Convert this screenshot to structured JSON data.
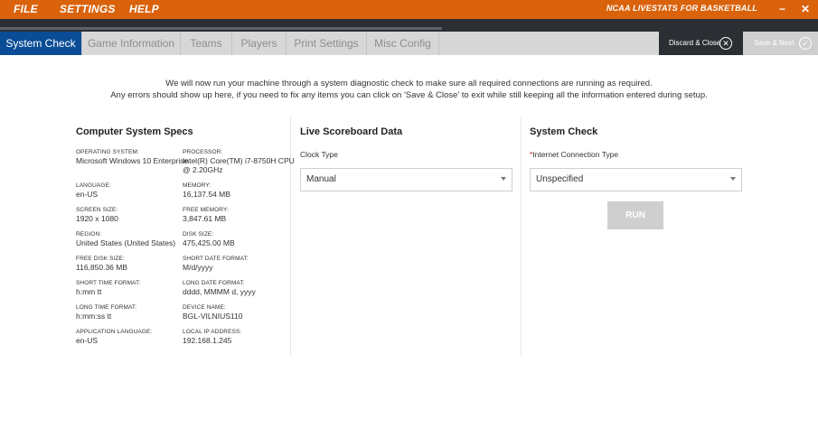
{
  "menu": {
    "file": "FILE",
    "settings": "SETTINGS",
    "help": "HELP"
  },
  "app_title": "NCAA LIVESTATS FOR BASKETBALL",
  "window": {
    "minimize": "−",
    "close": "✕"
  },
  "colors": {
    "brand_orange": "#d9620b",
    "active_tab": "#0a4c96",
    "dark_bar": "#2b2e33"
  },
  "progress_fraction": 0.54,
  "tabs": [
    {
      "label": "System Check"
    },
    {
      "label": "Game Information"
    },
    {
      "label": "Teams"
    },
    {
      "label": "Players"
    },
    {
      "label": "Print Settings"
    },
    {
      "label": "Misc Config"
    }
  ],
  "actions": {
    "discard_label": "Discard & Close",
    "discard_icon": "✕",
    "save_label": "Save & Next",
    "save_icon": "✓"
  },
  "intro": {
    "line1": "We will now run your machine through a system diagnostic check to make sure all required connections are running as required.",
    "line2": "Any errors should show up here, if you need to fix any items you can click on 'Save & Close' to exit while still keeping all the information entered during setup."
  },
  "specs": {
    "title": "Computer System Specs",
    "items": [
      {
        "label": "OPERATING SYSTEM:",
        "value": "Microsoft Windows 10 Enterprise"
      },
      {
        "label": "PROCESSOR:",
        "value": "Intel(R) Core(TM) i7-8750H CPU @ 2.20GHz"
      },
      {
        "label": "LANGUAGE:",
        "value": "en-US"
      },
      {
        "label": "MEMORY:",
        "value": "16,137.54 MB"
      },
      {
        "label": "SCREEN SIZE:",
        "value": "1920 x 1080"
      },
      {
        "label": "FREE MEMORY:",
        "value": "3,847.61 MB"
      },
      {
        "label": "REGION:",
        "value": "United States (United States)"
      },
      {
        "label": "DISK SIZE:",
        "value": "475,425.00 MB"
      },
      {
        "label": "FREE DISK SIZE:",
        "value": "116,850.36 MB"
      },
      {
        "label": "SHORT DATE FORMAT:",
        "value": "M/d/yyyy"
      },
      {
        "label": "SHORT TIME FORMAT:",
        "value": "h:mm tt"
      },
      {
        "label": "LONG DATE FORMAT:",
        "value": "dddd, MMMM d, yyyy"
      },
      {
        "label": "LONG TIME FORMAT:",
        "value": "h:mm:ss tt"
      },
      {
        "label": "DEVICE NAME:",
        "value": "BGL-VILNIUS110"
      },
      {
        "label": "APPLICATION LANGUAGE:",
        "value": "en-US"
      },
      {
        "label": "LOCAL IP ADDRESS:",
        "value": "192.168.1.245"
      }
    ]
  },
  "scoreboard": {
    "title": "Live Scoreboard Data",
    "clock_label": "Clock Type",
    "clock_value": "Manual"
  },
  "system_check": {
    "title": "System Check",
    "required_mark": "*",
    "conn_label": "Internet Connection Type",
    "conn_value": "Unspecified",
    "run_label": "RUN"
  }
}
